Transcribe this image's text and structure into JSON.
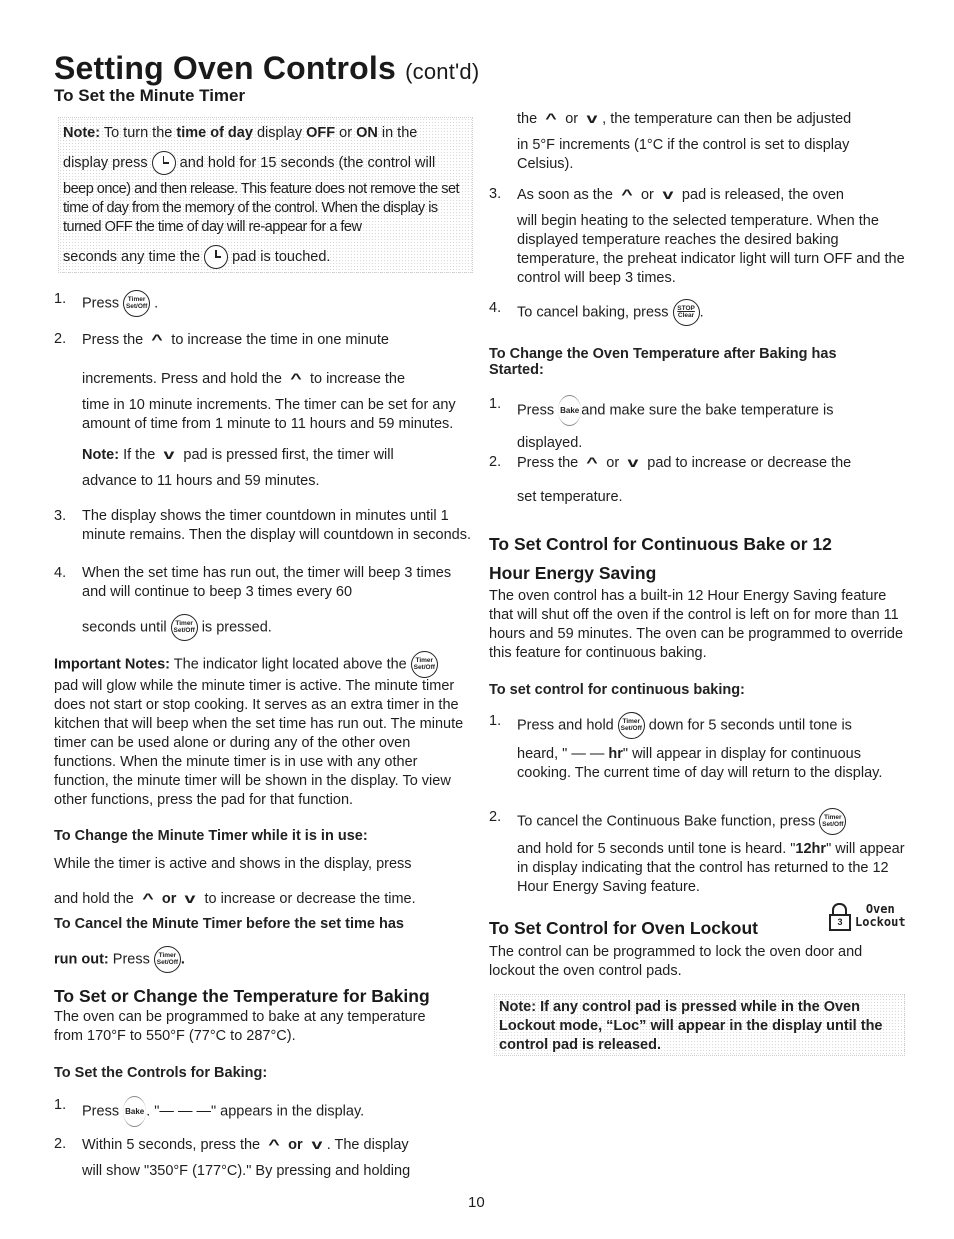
{
  "header": {
    "title": "Setting Oven Controls",
    "title_suffix": "(cont'd)",
    "subtitle": "To Set the Minute Timer"
  },
  "icons": {
    "timer_line1": "Timer",
    "timer_line2": "Set/Off",
    "stop_line1": "STOP",
    "stop_line2": "Clear",
    "bake": "Bake",
    "up_arrow": "^",
    "down_arrow": "v",
    "lock_digit": "3",
    "lock_label_1": "Oven",
    "lock_label_2": "Lockout"
  },
  "timer_note": {
    "label": "Note:",
    "p1a": " To turn the ",
    "p1b": "time of day",
    "p1c": " display ",
    "p1d": "OFF",
    "p1e": " or ",
    "p1f": "ON",
    "p1g": " in the",
    "p2a": "display press ",
    "p2b": " and hold for 15 seconds (the control will",
    "p3": "beep once) and then release. This feature does not remove the set time of day from the memory of the control. When the display is turned OFF the time of day will re-appear for a few",
    "p4a": "seconds any time the ",
    "p4b": " pad is touched."
  },
  "timer_steps": [
    {
      "num": "1.",
      "a": "Press ",
      "b": " ."
    },
    {
      "num": "2.",
      "a": "Press the ",
      "b": " to increase the time in one minute",
      "c": "increments. Press and hold the ",
      "d": " to increase the",
      "e": "time in 10 minute increments. The timer can be set for any amount of time from 1 minute to 11 hours and 59 minutes.",
      "note_label": "Note:",
      "note_a": " If the ",
      "note_b": " pad is pressed first, the timer will",
      "note_c": "advance to 11 hours and 59 minutes."
    },
    {
      "num": "3.",
      "a": "The display shows the timer countdown in minutes until 1 minute remains. Then the display will countdown in seconds."
    },
    {
      "num": "4.",
      "a": "When the set time has run out, the timer will beep 3 times and will continue to beep 3 times every 60",
      "b": "seconds until ",
      "c": " is pressed."
    }
  ],
  "important": {
    "label": "Important Notes:",
    "a": " The indicator light located above the ",
    "b": "pad will glow while the minute timer is active. The minute timer does not start or stop cooking. It serves as an extra timer in the kitchen that will beep when the set time has run out. The minute timer can be used alone or during any of the other oven functions. When the minute timer is in use with any other function, the minute timer will be shown in the display. To view other functions, press the pad for that function."
  },
  "change_timer": {
    "heading": "To Change the Minute Timer while it is in use:",
    "a": "While the timer is active and shows in the display, press",
    "b": "and hold the ",
    "c": " or ",
    "d": " to increase or decrease the time."
  },
  "cancel_timer": {
    "heading": "To Cancel the Minute Timer before the set time has",
    "b_label": "run out:",
    "b_text": " Press ",
    "b_end": "."
  },
  "temp_section": {
    "heading": "To Set or Change the Temperature for Baking",
    "intro": "The oven can be programmed to bake at any temperature from 170°F to 550°F (77°C to 287°C).",
    "sub": "To Set the Controls for Baking:",
    "s1_num": "1.",
    "s1a": "Press ",
    "s1b": ". \"— — —\" appears in the display.",
    "s2_num": "2.",
    "s2a": "Within 5 seconds, press the ",
    "s2or": " or ",
    "s2b": ". The display",
    "s2c": "will show \"350°F (177°C).\" By pressing and holding",
    "s2d_a": "the ",
    "s2d_or": " or ",
    "s2d_b": ", the temperature can then be adjusted",
    "s2e": "in 5°F increments (1°C if the control is set to display Celsius).",
    "s3_num": "3.",
    "s3a": "As soon as the ",
    "s3or": " or ",
    "s3b": " pad is released, the oven",
    "s3c": "will begin heating to the selected temperature. When the displayed temperature reaches the desired baking temperature, the preheat indicator light will turn OFF and the control will beep 3 times.",
    "s4_num": "4.",
    "s4a": "To cancel baking, press ",
    "s4b": "."
  },
  "change_temp": {
    "heading": "To Change the Oven Temperature after Baking has Started:",
    "s1_num": "1.",
    "s1a": "Press ",
    "s1b": "and make sure the bake temperature is",
    "s1c": "displayed.",
    "s2_num": "2.",
    "s2a": "Press the ",
    "s2or": " or ",
    "s2b": " pad to increase or decrease the",
    "s2c": "set temperature."
  },
  "continuous": {
    "heading1": "To Set Control for Continuous Bake or 12",
    "heading2": "Hour Energy Saving",
    "intro": "The oven control has a built-in 12 Hour Energy Saving feature that will shut off the oven if the control is left on for more than 11 hours and 59 minutes. The oven can be programmed to override this feature for continuous baking.",
    "sub": "To set control for continuous baking:",
    "s1_num": "1.",
    "s1a": "Press and hold ",
    "s1b": " down for 5 seconds until tone is",
    "s1c": "heard, \" — —  ",
    "s1d": "hr",
    "s1e": "\" will appear in display for continuous cooking. The current time of day will return to the display.",
    "s2_num": "2.",
    "s2a": "To cancel the Continuous Bake function, press",
    "s2b": "and hold for 5 seconds until tone is heard. \"",
    "s2c": "12hr",
    "s2d": "\" will appear in display indicating that the control has returned to the 12 Hour Energy Saving feature."
  },
  "lockout": {
    "heading": "To Set Control for Oven Lockout",
    "intro": "The control can be programmed to lock the oven door and lockout the oven control pads.",
    "note": "Note: If any control pad is pressed while in the Oven Lockout mode, “Loc” will appear in the display until the control pad is released."
  },
  "footer": {
    "page_number": "10"
  }
}
